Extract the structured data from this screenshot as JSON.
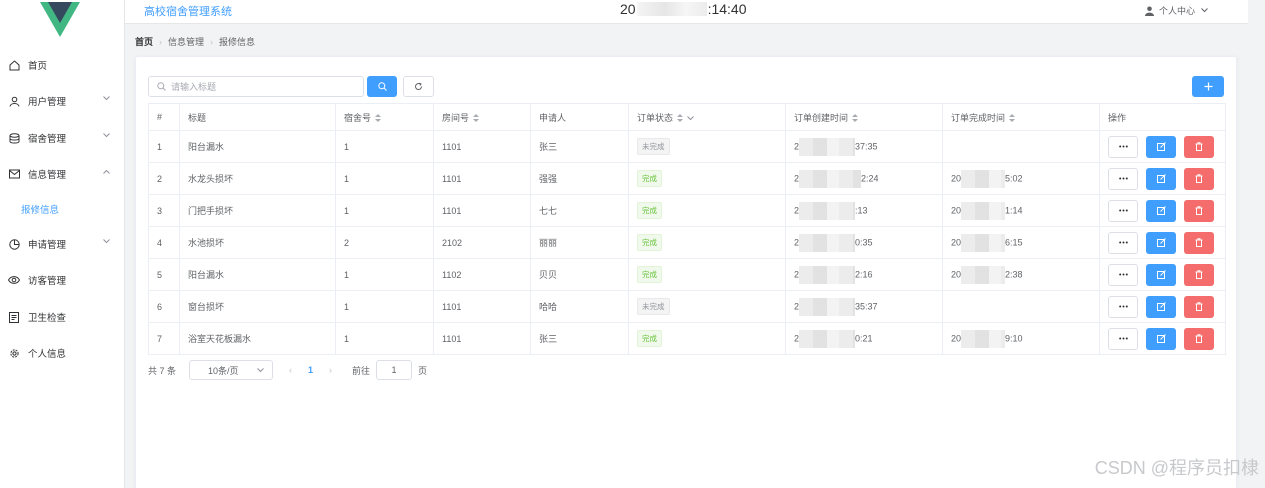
{
  "header": {
    "system_title": "高校宿舍管理系统",
    "clock_prefix": "20",
    "clock_suffix": ":14:40",
    "user_center_label": "个人中心"
  },
  "sidebar": {
    "items": [
      {
        "label": "首页",
        "icon": "home-icon"
      },
      {
        "label": "用户管理",
        "icon": "user-icon"
      },
      {
        "label": "宿舍管理",
        "icon": "database-icon"
      },
      {
        "label": "信息管理",
        "icon": "mail-icon"
      },
      {
        "label": "申请管理",
        "icon": "pie-chart-icon"
      },
      {
        "label": "访客管理",
        "icon": "eye-icon"
      },
      {
        "label": "卫生检查",
        "icon": "document-icon"
      },
      {
        "label": "个人信息",
        "icon": "gear-icon"
      }
    ],
    "sub_item": "报修信息"
  },
  "breadcrumb": [
    "首页",
    "信息管理",
    "报修信息"
  ],
  "toolbar": {
    "search_placeholder": "请输入标题"
  },
  "table": {
    "headers": [
      "#",
      "标题",
      "宿舍号",
      "房间号",
      "申请人",
      "订单状态",
      "订单创建时间",
      "订单完成时间",
      "操作"
    ],
    "rows": [
      {
        "index": "1",
        "title": "阳台漏水",
        "dorm": "1",
        "room": "1101",
        "applicant": "张三",
        "status": "未完成",
        "status_type": "pending",
        "created_prefix": "2",
        "created_suffix": "37:35",
        "finished_prefix": "",
        "finished_suffix": ""
      },
      {
        "index": "2",
        "title": "水龙头损坏",
        "dorm": "1",
        "room": "1101",
        "applicant": "强强",
        "status": "完成",
        "status_type": "done",
        "created_prefix": "2",
        "created_suffix": "2:24",
        "finished_prefix": "20",
        "finished_suffix": "5:02"
      },
      {
        "index": "3",
        "title": "门把手损坏",
        "dorm": "1",
        "room": "1101",
        "applicant": "七七",
        "status": "完成",
        "status_type": "done",
        "created_prefix": "2",
        "created_suffix": ":13",
        "finished_prefix": "20",
        "finished_suffix": "1:14"
      },
      {
        "index": "4",
        "title": "水池损坏",
        "dorm": "2",
        "room": "2102",
        "applicant": "丽丽",
        "status": "完成",
        "status_type": "done",
        "created_prefix": "2",
        "created_suffix": "0:35",
        "finished_prefix": "20",
        "finished_suffix": "6:15"
      },
      {
        "index": "5",
        "title": "阳台漏水",
        "dorm": "1",
        "room": "1102",
        "applicant": "贝贝",
        "status": "完成",
        "status_type": "done",
        "created_prefix": "2",
        "created_suffix": "2:16",
        "finished_prefix": "20",
        "finished_suffix": "2:38"
      },
      {
        "index": "6",
        "title": "窗台损坏",
        "dorm": "1",
        "room": "1101",
        "applicant": "哈哈",
        "status": "未完成",
        "status_type": "pending",
        "created_prefix": "2",
        "created_suffix": "35:37",
        "finished_prefix": "",
        "finished_suffix": ""
      },
      {
        "index": "7",
        "title": "浴室天花板漏水",
        "dorm": "1",
        "room": "1101",
        "applicant": "张三",
        "status": "完成",
        "status_type": "done",
        "created_prefix": "2",
        "created_suffix": "0:21",
        "finished_prefix": "20",
        "finished_suffix": "9:10"
      }
    ]
  },
  "pagination": {
    "total_label": "共 7 条",
    "page_size_label": "10条/页",
    "current_page": "1",
    "jump_label": "前往",
    "jump_value": "1",
    "jump_suffix": "页"
  },
  "watermark": "CSDN @程序员扣棣",
  "colors": {
    "primary": "#409eff",
    "danger": "#f56c6c",
    "success": "#67c23a",
    "logo_dark": "#35495e",
    "logo_green": "#41b883"
  }
}
